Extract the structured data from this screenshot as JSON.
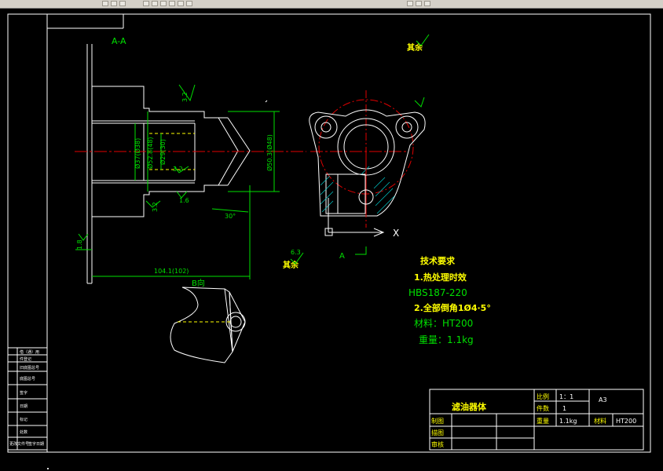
{
  "section_label": "A-A",
  "roughness_other": "其余",
  "roughness_val_main": "3.2",
  "roughness_val_low": "6.3",
  "dims": {
    "d37": "Ø37(Ø38)",
    "d52": "Ø52.8(48)",
    "d29": "Ø29(30)",
    "d50": "Ø50.3(Ø48)",
    "len": "104.1(102)",
    "angle": "30°",
    "r32a": "3.2",
    "r32b": "3.2",
    "r32c": "3.2",
    "r16": "1.6",
    "r18": "1.8"
  },
  "view_b": "B向",
  "view_a": "A",
  "axis_x": "X",
  "tech": {
    "title": "技术要求",
    "line1": "1.热处理时效",
    "line2": "HBS187-220",
    "line3": "2.全部倒角1Ø4·5°",
    "line4": "材料：HT200",
    "line5": "重量：1.1kg"
  },
  "title_block": {
    "part_name": "滤油器体",
    "scale_label": "比例",
    "scale_value": "1：1",
    "qty_label": "件数",
    "qty_value": "1",
    "size": "A3",
    "weight_label": "重量",
    "weight_value": "1.1kg",
    "material_label": "材料",
    "material_value": "HT200",
    "drawn": "制图",
    "design": "描图",
    "check": "审核"
  },
  "left_table": [
    "借（通）用",
    "件登记",
    "旧底图总号",
    "底图总号",
    "签字",
    "日期",
    "标记",
    "处数",
    "更改文件号",
    "签字日期"
  ],
  "colors": {
    "bg": "#000000",
    "line": "#ffffff",
    "dim": "#00e000",
    "center": "#e00000",
    "hatch": "#00c8c8",
    "text": "#ffff00"
  }
}
